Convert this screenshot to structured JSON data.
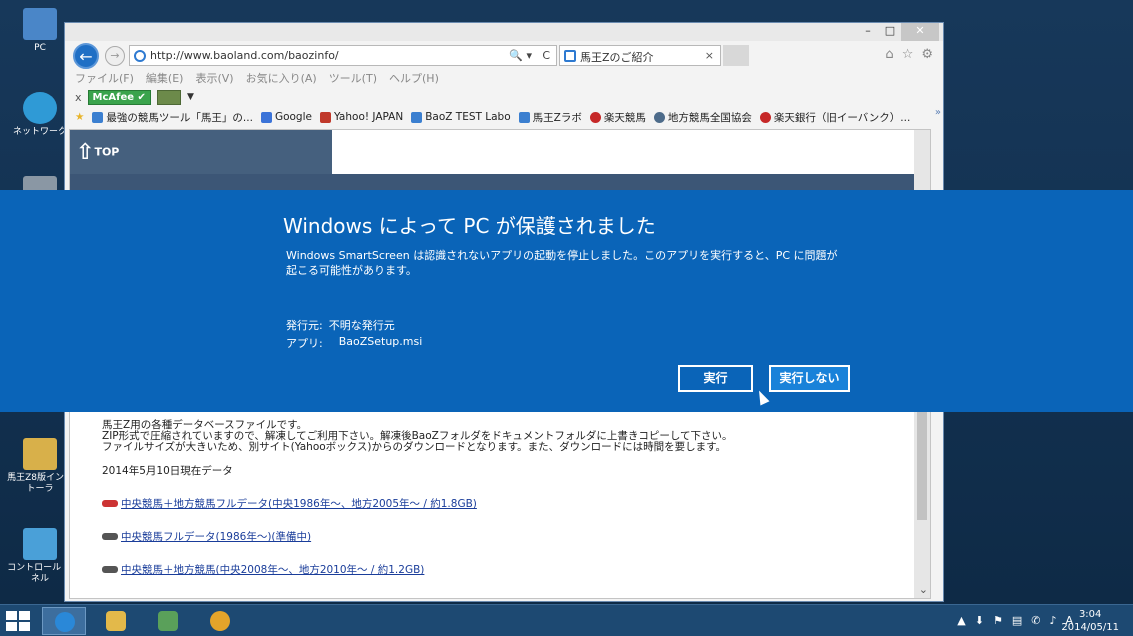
{
  "desktop": {
    "icons": [
      {
        "label": "PC",
        "icon": "computer-icon",
        "color": "#4a86c8"
      },
      {
        "label": "ネットワーク",
        "icon": "network-icon",
        "color": "#2f9ad6"
      },
      {
        "label": "",
        "icon": "recycle-bin-icon",
        "color": "#8a97a4"
      },
      {
        "label": "馬王Z8版インストーラ",
        "icon": "folder-icon",
        "color": "#d8b04a"
      },
      {
        "label": "コントロール パネル",
        "icon": "control-panel-icon",
        "color": "#4aa0d8"
      }
    ]
  },
  "browser": {
    "address": "http://www.baoland.com/baozinfo/",
    "search_glyph": "🔍 ▾",
    "refresh_glyph": "C",
    "tab_title": "馬王Zのご紹介",
    "tab_close": "×",
    "menus": [
      "ファイル(F)",
      "編集(E)",
      "表示(V)",
      "お気に入り(A)",
      "ツール(T)",
      "ヘルプ(H)"
    ],
    "mcafee_close": "x",
    "mcafee_label": "McAfee",
    "favorites": [
      {
        "label": "最強の競馬ツール「馬王」の...",
        "color": "#3b7fd0"
      },
      {
        "label": "Google",
        "color": "#3b73d8"
      },
      {
        "label": "Yahoo! JAPAN",
        "color": "#c0392b"
      },
      {
        "label": "BaoZ TEST Labo",
        "color": "#3b7fd0"
      },
      {
        "label": "馬王Zラボ",
        "color": "#3b7fd0"
      },
      {
        "label": "楽天競馬",
        "color": "#c62828"
      },
      {
        "label": "地方競馬全国協会",
        "color": "#4d6b8a"
      },
      {
        "label": "楽天銀行（旧イーバンク）...",
        "color": "#c62828"
      }
    ],
    "fav_more": "»"
  },
  "page": {
    "top_label": "TOP",
    "description": [
      "馬王Z用の各種データベースファイルです。",
      "ZIP形式で圧縮されていますので、解凍してご利用下さい。解凍後BaoZフォルダをドキュメントフォルダに上書きコピーして下さい。",
      "ファイルサイズが大きいため、別サイト(Yahooボックス)からのダウンロードとなります。また、ダウンロードには時間を要します。"
    ],
    "date_line": "2014年5月10日現在データ",
    "links": [
      "中央競馬＋地方競馬フルデータ(中央1986年～、地方2005年～ / 約1.8GB)",
      "中央競馬フルデータ(1986年～)(準備中)",
      "中央競馬＋地方競馬(中央2008年～、地方2010年～ / 約1.2GB)"
    ]
  },
  "smartscreen": {
    "title": "Windows によって PC が保護されました",
    "body": "Windows SmartScreen は認識されないアプリの起動を停止しました。このアプリを実行すると、PC に問題が起こる可能性があります。",
    "publisher_label": "発行元:",
    "publisher_value": "不明な発行元",
    "app_label": "アプリ:",
    "app_value": "BaoZSetup.msi",
    "run_label": "実行",
    "dont_run_label": "実行しない",
    "bg_color": "#0a64b8"
  },
  "taskbar": {
    "apps": [
      {
        "name": "internet-explorer",
        "icon": "ie-icon",
        "color": "#2a88d8",
        "active": true
      },
      {
        "name": "file-explorer",
        "icon": "folder-icon",
        "color": "#e3b94a",
        "active": false
      },
      {
        "name": "photo-app",
        "icon": "photo-icon",
        "color": "#5aa05a",
        "active": false
      },
      {
        "name": "chrome",
        "icon": "chrome-icon",
        "color": "#e4a42a",
        "active": false
      }
    ],
    "tray": [
      "▲",
      "⬇",
      "⚑",
      "▤",
      "✆",
      "♪",
      "A"
    ],
    "time": "3:04",
    "date": "2014/05/11"
  }
}
